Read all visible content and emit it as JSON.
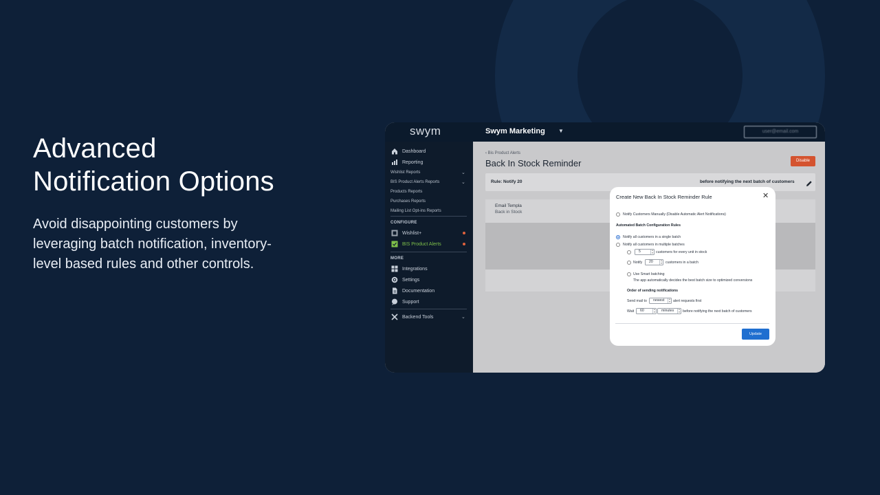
{
  "hero": {
    "title_line1": "Advanced",
    "title_line2": "Notification Options",
    "description": "Avoid disappointing customers by leveraging batch notification, inventory-level based rules and other controls."
  },
  "topbar": {
    "logo": "swym",
    "store_name": "Swym Marketing",
    "user_email": "user@email.com"
  },
  "sidebar": {
    "dashboard": "Dashboard",
    "reporting": "Reporting",
    "wishlist_reports": "Wishlist Reports",
    "bis_reports": "BIS Product Alerts Reports",
    "products_reports": "Products Reports",
    "purchases_reports": "Purchases Reports",
    "mailing_reports": "Mailing List Opt-ins Reports",
    "configure_heading": "CONFIGURE",
    "wishlist_plus": "Wishlist+",
    "bis_alerts": "BIS Product Alerts",
    "more_heading": "MORE",
    "integrations": "Integrations",
    "settings": "Settings",
    "documentation": "Documentation",
    "support": "Support",
    "backend_tools": "Backend Tools"
  },
  "main": {
    "breadcrumb": "Bis Product Alerts",
    "page_title": "Back In Stock Reminder",
    "disable_label": "Disable",
    "rule_left": "Rule: Notify 20",
    "rule_right": "before notifying the next batch of customers",
    "email_label": "Email Templa",
    "email_sub": "Back in Stock"
  },
  "modal": {
    "title": "Create New Back In Stock Reminder Rule",
    "manual_option": "Notify Customers Manually (Disable Automatic Alert Notifications)",
    "batch_heading": "Automated Batch Configuration Rules",
    "single_batch": "Notify all customers in a single batch",
    "multiple_batches": "Notify all customers in multiple batches",
    "per_unit_value": "5",
    "per_unit_label": "customers for every unit in stock",
    "notify_label": "Notify",
    "notify_value": "20",
    "notify_suffix": "customers in a batch",
    "smart_label": "Use Smart batching",
    "smart_desc": "The app automatically decides the best batch size to optimized conversions",
    "order_heading": "Order of sending notifications",
    "send_mail_label": "Send mail to",
    "send_mail_value": "newest",
    "send_mail_suffix": "alert requests first",
    "wait_label": "Wait",
    "wait_value": "60",
    "wait_unit": "minutes",
    "wait_suffix": "before notifying the next batch of customers",
    "update_label": "Update"
  },
  "colors": {
    "background": "#0e2038",
    "accent_blue": "#1f6fd0",
    "disable_orange": "#d4532f",
    "active_green": "#7ec04a"
  }
}
